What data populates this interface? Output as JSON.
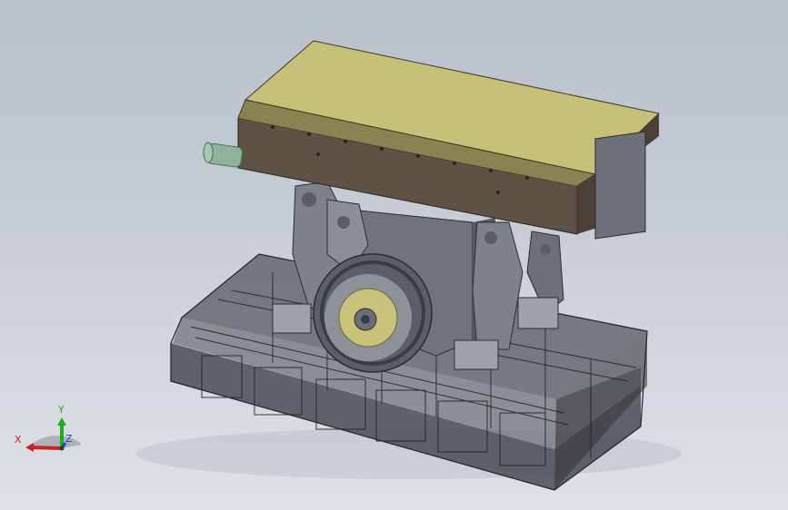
{
  "viewport": {
    "background_top": "#b9c0ca",
    "background_bottom": "#dee1e5"
  },
  "model": {
    "top_plate_color": "#c6c078",
    "housing_color": "#5e5245",
    "frame_color": "#4a4c52",
    "mechanism_color": "#7a7e88",
    "pulley_inner_color": "#c8c27a",
    "cylinder_color": "#8fb39a"
  },
  "triad": {
    "x_label": "X",
    "y_label": "Y",
    "z_label": "Z",
    "x_color": "#cc2222",
    "y_color": "#22aa22",
    "z_color": "#2244cc"
  }
}
